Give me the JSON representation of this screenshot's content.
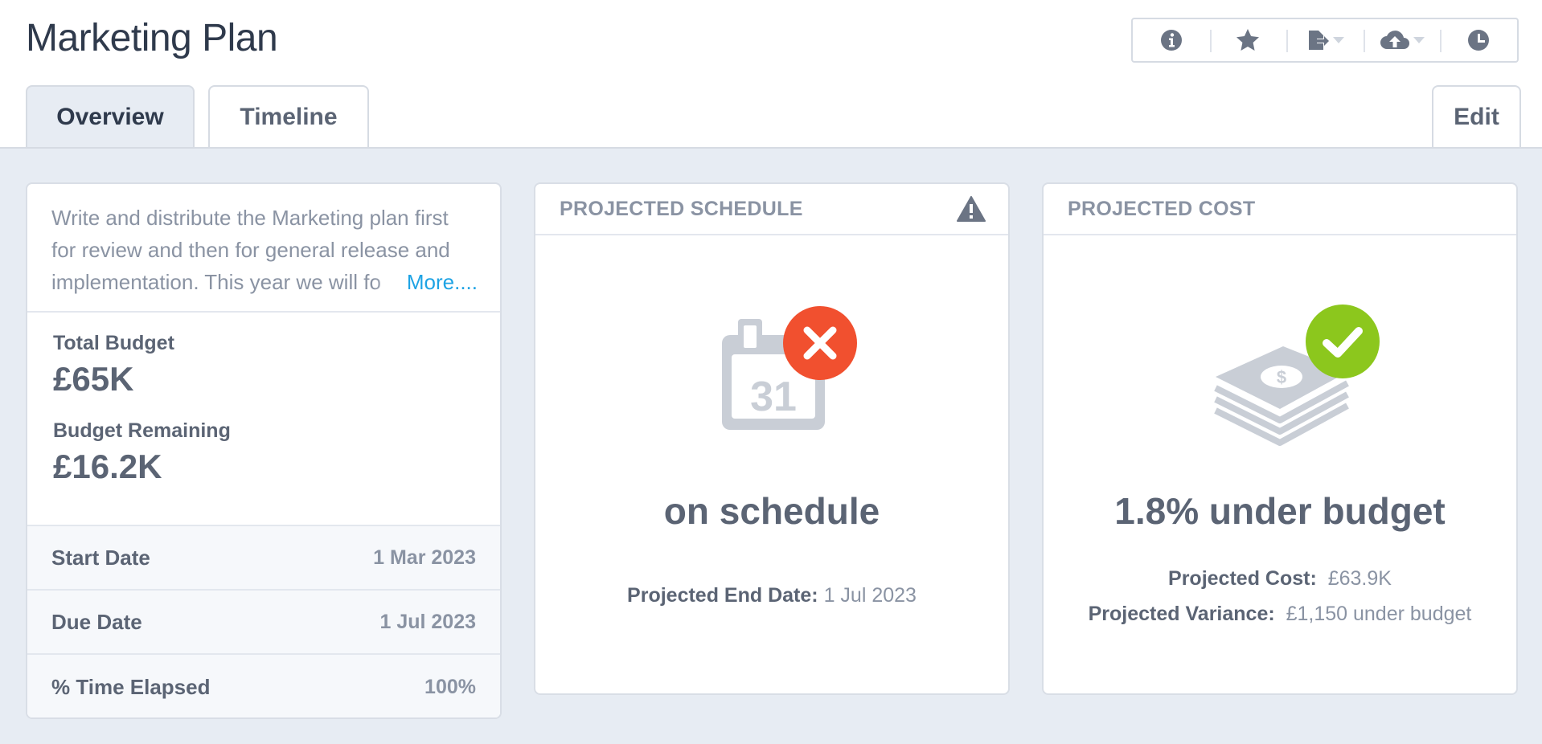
{
  "header": {
    "title": "Marketing Plan",
    "toolbar": [
      {
        "icon": "info-icon"
      },
      {
        "icon": "star-icon"
      },
      {
        "icon": "export-icon",
        "dropdown": true
      },
      {
        "icon": "cloud-upload-icon",
        "dropdown": true
      },
      {
        "icon": "clock-icon"
      }
    ]
  },
  "tabs": {
    "overview": "Overview",
    "timeline": "Timeline",
    "active": "Overview",
    "edit": "Edit"
  },
  "info_card": {
    "description": "Write and distribute the Marketing plan first for review and then for general release and implementation. This year we will fo",
    "more_link": "More....",
    "total_budget_label": "Total Budget",
    "total_budget_value": "£65K",
    "budget_remaining_label": "Budget Remaining",
    "budget_remaining_value": "£16.2K",
    "rows": [
      {
        "label": "Start Date",
        "value": "1 Mar 2023"
      },
      {
        "label": "Due Date",
        "value": "1 Jul 2023"
      },
      {
        "label": "% Time Elapsed",
        "value": "100%"
      }
    ]
  },
  "schedule_card": {
    "title": "PROJECTED SCHEDULE",
    "calendar_day": "31",
    "status": "on schedule",
    "end_date_label": "Projected End Date:",
    "end_date_value": "1 Jul 2023"
  },
  "cost_card": {
    "title": "PROJECTED COST",
    "status": "1.8% under budget",
    "cost_label": "Projected Cost:",
    "cost_value": "£63.9K",
    "variance_label": "Projected Variance:",
    "variance_value": "£1,150 under budget"
  },
  "colors": {
    "accent_link": "#1ea3e4",
    "error_badge": "#f1502f",
    "success_badge": "#8cc71d",
    "icon_gray": "#c9ced6",
    "text_dark": "#2f3a4c",
    "background": "#e7ecf3"
  }
}
